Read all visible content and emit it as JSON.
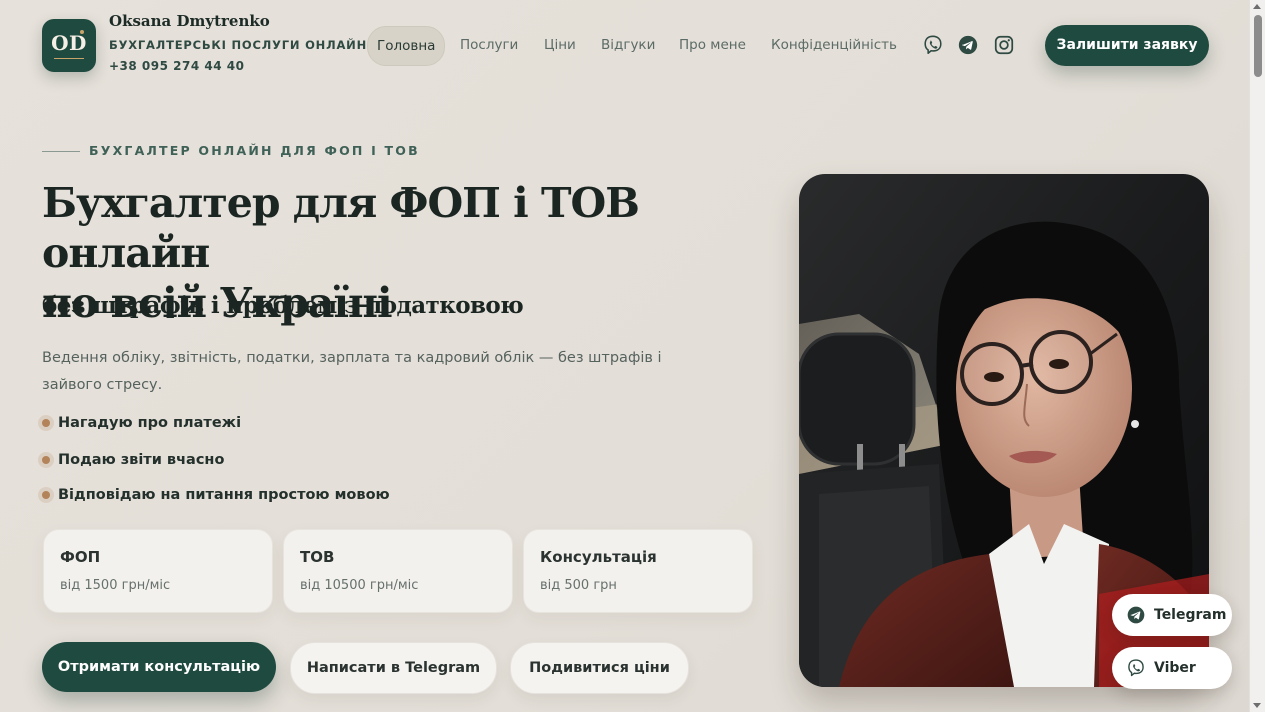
{
  "header": {
    "logo_text": "OD",
    "brand_name": "Oksana Dmytrenko",
    "brand_subtitle": "БУХГАЛТЕРСЬКІ ПОСЛУГИ ОНЛАЙН",
    "phone": "+38 095 274 44 40",
    "nav": [
      {
        "label": "Головна",
        "active": true
      },
      {
        "label": "Послуги"
      },
      {
        "label": "Ціни"
      },
      {
        "label": "Відгуки"
      },
      {
        "label": "Про мене"
      },
      {
        "label": "Конфіденційність"
      }
    ],
    "social_icons": [
      "viber-icon",
      "telegram-icon",
      "instagram-icon"
    ],
    "cta_label": "Залишити заявку"
  },
  "hero": {
    "eyebrow": "БУХГАЛТЕР ОНЛАЙН ДЛЯ ФОП І ТОВ",
    "title_line1": "Бухгалтер для ФОП і ТОВ онлайн",
    "title_line2": "по всій Україні",
    "subtitle": "без штрафів і проблем з податковою",
    "lead": "Ведення обліку, звітність, податки, зарплата та кадровий облік — без штрафів і зайвого стресу.",
    "bullets": [
      "Нагадую про платежі",
      "Подаю звіти вчасно",
      "Відповідаю на питання простою мовою"
    ],
    "cards": [
      {
        "title": "ФОП",
        "price": "від 1500 грн/міс"
      },
      {
        "title": "ТОВ",
        "price": "від 10500 грн/міс"
      },
      {
        "title": "Консультація",
        "price": "від 500 грн"
      }
    ],
    "buttons": {
      "primary": "Отримати консультацію",
      "telegram": "Написати в Telegram",
      "prices": "Подивитися ціни"
    }
  },
  "floating": {
    "telegram": "Telegram",
    "viber": "Viber"
  },
  "colors": {
    "accent": "#1f4a3f",
    "background": "#e4dfd8",
    "bullet": "#b3835a"
  }
}
